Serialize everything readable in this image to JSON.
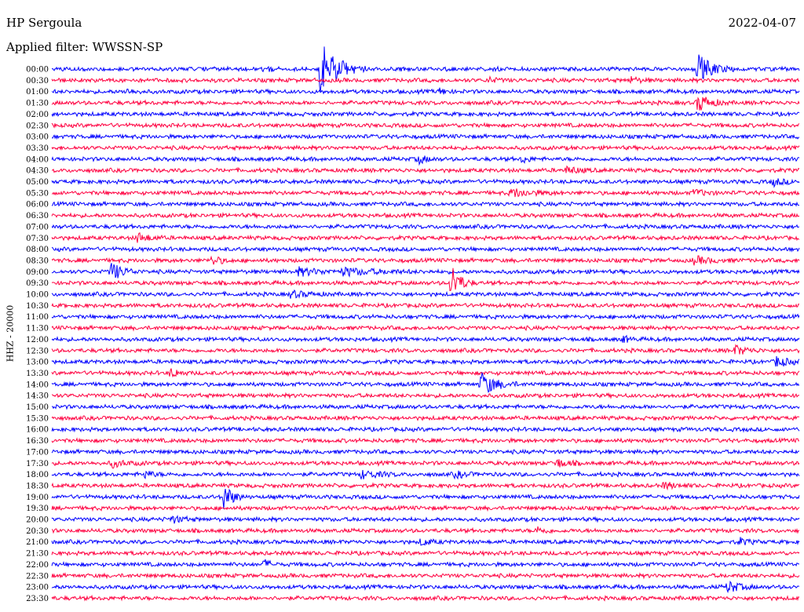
{
  "header": {
    "station": "HP Sergoula",
    "date": "2022-04-07",
    "filter": "Applied filter: WWSSN-SP",
    "channel": "HHZ - 20000"
  },
  "chart_data": {
    "type": "line",
    "title": "HP Sergoula",
    "subtitle": "Applied filter: WWSSN-SP",
    "ylabel": "HHZ - 20000",
    "row_labels": [
      "00:00",
      "00:30",
      "01:00",
      "01:30",
      "02:00",
      "02:30",
      "03:00",
      "03:30",
      "04:00",
      "04:30",
      "05:00",
      "05:30",
      "06:00",
      "06:30",
      "07:00",
      "07:30",
      "08:00",
      "08:30",
      "09:00",
      "09:30",
      "10:00",
      "10:30",
      "11:00",
      "11:30",
      "12:00",
      "12:30",
      "13:00",
      "13:30",
      "14:00",
      "14:30",
      "15:00",
      "15:30",
      "16:00",
      "16:30",
      "17:00",
      "17:30",
      "18:00",
      "18:30",
      "19:00",
      "19:30",
      "20:00",
      "20:30",
      "21:00",
      "21:30",
      "22:00",
      "22:30",
      "23:00",
      "23:30"
    ],
    "row_colors": [
      "#0000ff",
      "#ff0040"
    ],
    "row_minutes": 30,
    "grid": false,
    "events": [
      {
        "row": 0,
        "x": 0.285,
        "amp": 1.2,
        "dur": 0.02
      },
      {
        "row": 0,
        "x": 0.36,
        "amp": 12.0,
        "dur": 0.06
      },
      {
        "row": 0,
        "x": 0.865,
        "amp": 6.0,
        "dur": 0.05
      },
      {
        "row": 1,
        "x": 0.585,
        "amp": 1.0,
        "dur": 0.03
      },
      {
        "row": 1,
        "x": 0.775,
        "amp": 1.2,
        "dur": 0.03
      },
      {
        "row": 2,
        "x": 0.1,
        "amp": 1.0,
        "dur": 0.03
      },
      {
        "row": 2,
        "x": 0.52,
        "amp": 1.5,
        "dur": 0.02
      },
      {
        "row": 3,
        "x": 0.865,
        "amp": 4.0,
        "dur": 0.04
      },
      {
        "row": 8,
        "x": 0.49,
        "amp": 1.8,
        "dur": 0.03
      },
      {
        "row": 8,
        "x": 0.63,
        "amp": 1.6,
        "dur": 0.02
      },
      {
        "row": 9,
        "x": 0.69,
        "amp": 1.6,
        "dur": 0.04
      },
      {
        "row": 10,
        "x": 0.965,
        "amp": 1.5,
        "dur": 0.04
      },
      {
        "row": 11,
        "x": 0.615,
        "amp": 1.8,
        "dur": 0.07
      },
      {
        "row": 11,
        "x": 0.86,
        "amp": 1.4,
        "dur": 0.04
      },
      {
        "row": 15,
        "x": 0.115,
        "amp": 2.0,
        "dur": 0.04
      },
      {
        "row": 17,
        "x": 0.215,
        "amp": 2.0,
        "dur": 0.03
      },
      {
        "row": 17,
        "x": 0.86,
        "amp": 1.5,
        "dur": 0.06
      },
      {
        "row": 18,
        "x": 0.08,
        "amp": 4.0,
        "dur": 0.04
      },
      {
        "row": 18,
        "x": 0.33,
        "amp": 1.5,
        "dur": 0.08
      },
      {
        "row": 18,
        "x": 0.39,
        "amp": 1.4,
        "dur": 0.12
      },
      {
        "row": 19,
        "x": 0.535,
        "amp": 8.0,
        "dur": 0.03
      },
      {
        "row": 20,
        "x": 0.32,
        "amp": 1.3,
        "dur": 0.06
      },
      {
        "row": 24,
        "x": 0.765,
        "amp": 1.3,
        "dur": 0.02
      },
      {
        "row": 25,
        "x": 0.915,
        "amp": 2.0,
        "dur": 0.04
      },
      {
        "row": 26,
        "x": 0.97,
        "amp": 2.2,
        "dur": 0.04
      },
      {
        "row": 27,
        "x": 0.16,
        "amp": 1.8,
        "dur": 0.03
      },
      {
        "row": 28,
        "x": 0.575,
        "amp": 5.0,
        "dur": 0.05
      },
      {
        "row": 35,
        "x": 0.08,
        "amp": 1.5,
        "dur": 0.05
      },
      {
        "row": 35,
        "x": 0.675,
        "amp": 1.8,
        "dur": 0.04
      },
      {
        "row": 36,
        "x": 0.125,
        "amp": 1.5,
        "dur": 0.03
      },
      {
        "row": 36,
        "x": 0.415,
        "amp": 1.6,
        "dur": 0.06
      },
      {
        "row": 36,
        "x": 0.54,
        "amp": 1.3,
        "dur": 0.04
      },
      {
        "row": 37,
        "x": 0.82,
        "amp": 1.3,
        "dur": 0.04
      },
      {
        "row": 38,
        "x": 0.23,
        "amp": 6.0,
        "dur": 0.03
      },
      {
        "row": 40,
        "x": 0.16,
        "amp": 1.5,
        "dur": 0.04
      },
      {
        "row": 41,
        "x": 0.65,
        "amp": 1.4,
        "dur": 0.03
      },
      {
        "row": 42,
        "x": 0.495,
        "amp": 1.5,
        "dur": 0.03
      },
      {
        "row": 42,
        "x": 0.92,
        "amp": 1.4,
        "dur": 0.03
      },
      {
        "row": 44,
        "x": 0.285,
        "amp": 1.8,
        "dur": 0.02
      },
      {
        "row": 46,
        "x": 0.905,
        "amp": 2.5,
        "dur": 0.04
      }
    ]
  }
}
